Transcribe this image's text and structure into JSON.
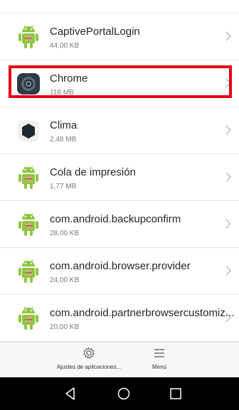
{
  "apps": [
    {
      "name": "CaptivePortalLogin",
      "size": "44,00 KB",
      "icon": "android-icon"
    },
    {
      "name": "Chrome",
      "size": "118 MB",
      "icon": "chrome-icon"
    },
    {
      "name": "Clima",
      "size": "2,48 MB",
      "icon": "weather-icon"
    },
    {
      "name": "Cola de impresión",
      "size": "1,77 MB",
      "icon": "android-icon"
    },
    {
      "name": "com.android.backupconfirm",
      "size": "28,00 KB",
      "icon": "android-icon"
    },
    {
      "name": "com.android.browser.provider",
      "size": "24,00 KB",
      "icon": "android-icon"
    },
    {
      "name": "com.android.partnerbrowsercustomiz...",
      "size": "20,00 KB",
      "icon": "android-icon"
    }
  ],
  "bottom_bar": {
    "settings_label": "Ajustes de aplicaciones...",
    "menu_label": "Menú"
  },
  "colors": {
    "highlight": "#e60012",
    "android_green": "#8dc63f"
  }
}
